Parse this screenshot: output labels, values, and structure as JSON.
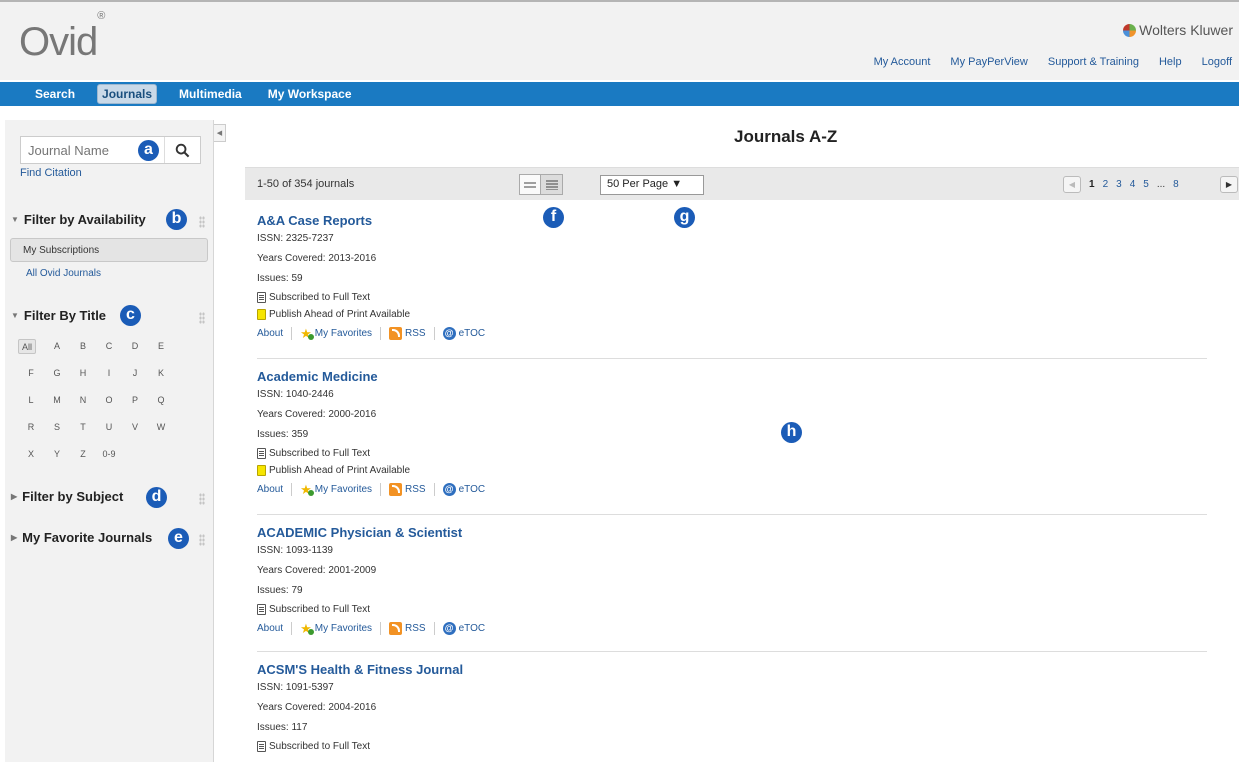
{
  "header": {
    "logo_text": "Ovid",
    "logo_mark": "®",
    "brand": "Wolters Kluwer",
    "links": [
      "My Account",
      "My PayPerView",
      "Support & Training",
      "Help",
      "Logoff"
    ]
  },
  "nav": {
    "items": [
      "Search",
      "Journals",
      "Multimedia",
      "My Workspace"
    ],
    "active": "Journals"
  },
  "sidebar": {
    "search_placeholder": "Journal Name",
    "find_citation": "Find Citation",
    "filter_availability": "Filter by Availability",
    "my_subscriptions": "My Subscriptions",
    "all_ovid_journals": "All Ovid Journals",
    "filter_title": "Filter By Title",
    "letters": [
      "All",
      "A",
      "B",
      "C",
      "D",
      "E",
      "F",
      "G",
      "H",
      "I",
      "J",
      "K",
      "L",
      "M",
      "N",
      "O",
      "P",
      "Q",
      "R",
      "S",
      "T",
      "U",
      "V",
      "W",
      "X",
      "Y",
      "Z",
      "0-9"
    ],
    "filter_subject": "Filter by Subject",
    "favorite_journals": "My Favorite Journals"
  },
  "main": {
    "title": "Journals A-Z",
    "results_count": "1-50 of 354 journals",
    "per_page": "50  Per Page",
    "pages": [
      "1",
      "2",
      "3",
      "4",
      "5",
      "...",
      "8"
    ],
    "current_page": "1"
  },
  "callouts": {
    "a": "a",
    "b": "b",
    "c": "c",
    "d": "d",
    "e": "e",
    "f": "f",
    "g": "g",
    "h": "h"
  },
  "journals": [
    {
      "title": "A&A Case Reports",
      "issn": "ISSN: 2325-7237",
      "years": "Years Covered: 2013-2016",
      "issues": "Issues: 59",
      "subscribed": "Subscribed to Full Text",
      "ahead": "Publish Ahead of Print Available"
    },
    {
      "title": "Academic Medicine",
      "issn": "ISSN: 1040-2446",
      "years": "Years Covered: 2000-2016",
      "issues": "Issues: 359",
      "subscribed": "Subscribed to Full Text",
      "ahead": "Publish Ahead of Print Available"
    },
    {
      "title": "ACADEMIC Physician & Scientist",
      "issn": "ISSN: 1093-1139",
      "years": "Years Covered: 2001-2009",
      "issues": "Issues: 79",
      "subscribed": "Subscribed to Full Text"
    },
    {
      "title": "ACSM'S Health & Fitness Journal",
      "issn": "ISSN: 1091-5397",
      "years": "Years Covered: 2004-2016",
      "issues": "Issues: 117",
      "subscribed": "Subscribed to Full Text"
    }
  ],
  "actions": {
    "about": "About",
    "favorites": "My Favorites",
    "rss": "RSS",
    "etoc": "eTOC"
  },
  "colors": {
    "nav": "#1a7ac2",
    "link": "#245a9a",
    "callout": "#1b5cb7"
  }
}
